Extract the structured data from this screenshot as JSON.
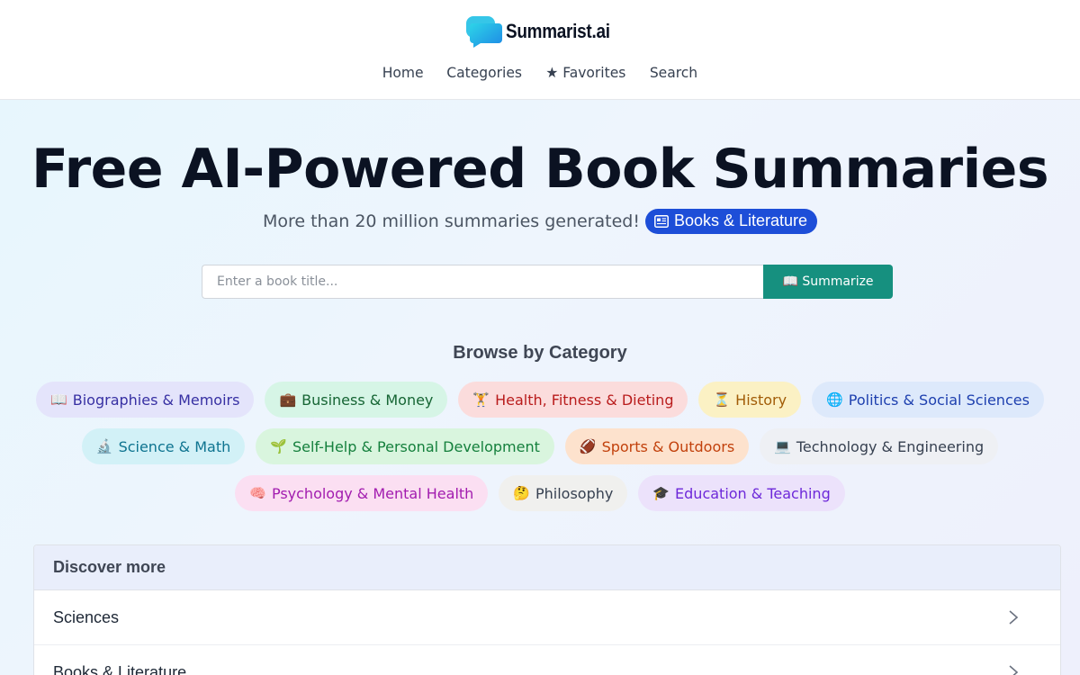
{
  "header": {
    "brand": "Summarist.ai",
    "nav": [
      {
        "label": "Home"
      },
      {
        "label": "Categories"
      },
      {
        "label": "★ Favorites"
      },
      {
        "label": "Search"
      }
    ]
  },
  "hero": {
    "title": "Free AI-Powered Book Summaries",
    "subtitle": "More than 20 million summaries generated!",
    "badge": "Books & Literature"
  },
  "search": {
    "placeholder": "Enter a book title...",
    "button": "📖 Summarize"
  },
  "browse": {
    "title": "Browse by Category",
    "rows": [
      [
        {
          "emoji": "📖",
          "label": "Biographies & Memoirs",
          "bg": "#e4e4fb",
          "fg": "#3730a3"
        },
        {
          "emoji": "💼",
          "label": "Business & Money",
          "bg": "#d6f5e6",
          "fg": "#166534"
        },
        {
          "emoji": "🏋",
          "label": "Health, Fitness & Dieting",
          "bg": "#fbdcdc",
          "fg": "#b91c1c"
        },
        {
          "emoji": "⏳",
          "label": "History",
          "bg": "#fbf1c4",
          "fg": "#a15c07"
        },
        {
          "emoji": "🌐",
          "label": "Politics & Social Sciences",
          "bg": "#dde9fb",
          "fg": "#1e40af"
        }
      ],
      [
        {
          "emoji": "🔬",
          "label": "Science & Math",
          "bg": "#d2f1f7",
          "fg": "#0e7490"
        },
        {
          "emoji": "🌱",
          "label": "Self-Help & Personal Development",
          "bg": "#d9f5de",
          "fg": "#15803d"
        },
        {
          "emoji": "🏈",
          "label": "Sports & Outdoors",
          "bg": "#fde2cd",
          "fg": "#c2410c"
        },
        {
          "emoji": "💻",
          "label": "Technology & Engineering",
          "bg": "#eef0f4",
          "fg": "#374151"
        }
      ],
      [
        {
          "emoji": "🧠",
          "label": "Psychology & Mental Health",
          "bg": "#fbdff2",
          "fg": "#a21caf"
        },
        {
          "emoji": "🤔",
          "label": "Philosophy",
          "bg": "#f0f0ee",
          "fg": "#374151"
        },
        {
          "emoji": "🎓",
          "label": "Education & Teaching",
          "bg": "#ece2fb",
          "fg": "#6d28d9"
        }
      ]
    ]
  },
  "discover": {
    "title": "Discover more",
    "items": [
      {
        "label": "Sciences"
      },
      {
        "label": "Books & Literature"
      }
    ]
  }
}
